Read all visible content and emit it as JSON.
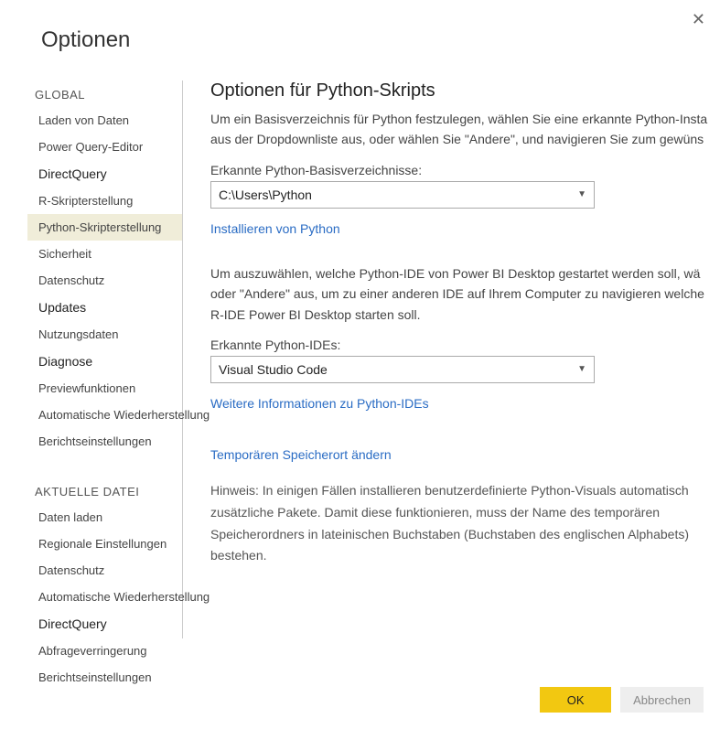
{
  "dialog": {
    "title": "Optionen",
    "close_icon": "✕"
  },
  "sidebar": {
    "global_header": "GLOBAL",
    "global_items": [
      {
        "label": "Laden von Daten",
        "bold": false,
        "selected": false
      },
      {
        "label": "Power Query-Editor",
        "bold": false,
        "selected": false
      },
      {
        "label": "DirectQuery",
        "bold": true,
        "selected": false
      },
      {
        "label": "R-Skripterstellung",
        "bold": false,
        "selected": false
      },
      {
        "label": "Python-Skripterstellung",
        "bold": false,
        "selected": true
      },
      {
        "label": "Sicherheit",
        "bold": false,
        "selected": false
      },
      {
        "label": "Datenschutz",
        "bold": false,
        "selected": false
      },
      {
        "label": "Updates",
        "bold": true,
        "selected": false
      },
      {
        "label": "Nutzungsdaten",
        "bold": false,
        "selected": false
      },
      {
        "label": "Diagnose",
        "bold": true,
        "selected": false
      },
      {
        "label": "Previewfunktionen",
        "bold": false,
        "selected": false
      },
      {
        "label": "Automatische Wiederherstellung",
        "bold": false,
        "selected": false
      },
      {
        "label": "Berichtseinstellungen",
        "bold": false,
        "selected": false
      }
    ],
    "aktuelle_header": "AKTUELLE DATEI",
    "aktuelle_items": [
      {
        "label": "Daten laden",
        "bold": false
      },
      {
        "label": "Regionale Einstellungen",
        "bold": false
      },
      {
        "label": "Datenschutz",
        "bold": false
      },
      {
        "label": "Automatische Wiederherstellung",
        "bold": false
      },
      {
        "label": "DirectQuery",
        "bold": true
      },
      {
        "label": "Abfrageverringerung",
        "bold": false
      },
      {
        "label": "Berichtseinstellungen",
        "bold": false
      }
    ]
  },
  "content": {
    "title": "Optionen für Python-Skripts",
    "intro": "Um ein Basisverzeichnis für Python festzulegen, wählen Sie eine erkannte Python-Insta aus der Dropdownliste aus, oder wählen Sie \"Andere\", und navigieren Sie zum gewüns",
    "dir_label": "Erkannte Python-Basisverzeichnisse:",
    "dir_value": "C:\\Users\\Python",
    "install_link": "Installieren von Python",
    "ide_intro": "Um auszuwählen, welche Python-IDE von Power BI Desktop gestartet werden soll, wä oder \"Andere\" aus, um zu einer anderen IDE auf Ihrem Computer zu navigieren welche R-IDE Power BI Desktop starten soll.",
    "ide_label": "Erkannte Python-IDEs:",
    "ide_value": "Visual Studio Code",
    "ide_link": "Weitere Informationen zu Python-IDEs",
    "temp_link": "Temporären Speicherort ändern",
    "hint": "Hinweis: In einigen Fällen installieren benutzerdefinierte Python-Visuals automatisch zusätzliche Pakete. Damit diese funktionieren, muss der Name des temporären Speicherordners in lateinischen Buchstaben (Buchstaben des englischen Alphabets) bestehen."
  },
  "footer": {
    "ok": "OK",
    "cancel": "Abbrechen"
  }
}
